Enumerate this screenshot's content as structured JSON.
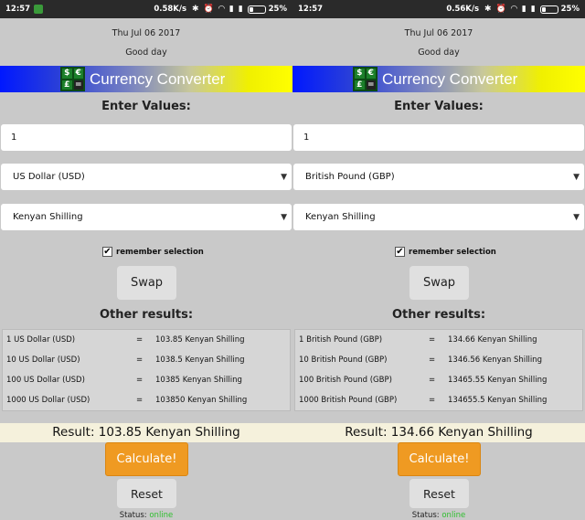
{
  "screens": [
    {
      "statusbar": {
        "time": "12:57",
        "speed": "0.58K/s",
        "battery": "25%"
      },
      "date": "Thu Jul 06 2017",
      "greeting": "Good day",
      "title": "Currency Converter",
      "enter_label": "Enter Values:",
      "amount": "1",
      "from_currency": "US Dollar (USD)",
      "to_currency": "Kenyan Shilling",
      "remember_label": "remember selection",
      "swap_label": "Swap",
      "other_results_label": "Other results:",
      "rows": [
        {
          "from": "1 US Dollar (USD)",
          "eq": "=",
          "to": "103.85 Kenyan Shilling"
        },
        {
          "from": "10 US Dollar (USD)",
          "eq": "=",
          "to": "1038.5 Kenyan Shilling"
        },
        {
          "from": "100 US Dollar (USD)",
          "eq": "=",
          "to": "10385 Kenyan Shilling"
        },
        {
          "from": "1000 US Dollar (USD)",
          "eq": "=",
          "to": "103850 Kenyan Shilling"
        }
      ],
      "result": "Result: 103.85 Kenyan Shilling",
      "calculate_label": "Calculate!",
      "reset_label": "Reset",
      "status_prefix": "Status:",
      "status_value": "online"
    },
    {
      "statusbar": {
        "time": "12:57",
        "speed": "0.56K/s",
        "battery": "25%"
      },
      "date": "Thu Jul 06 2017",
      "greeting": "Good day",
      "title": "Currency Converter",
      "enter_label": "Enter Values:",
      "amount": "1",
      "from_currency": "British Pound (GBP)",
      "to_currency": "Kenyan Shilling",
      "remember_label": "remember selection",
      "swap_label": "Swap",
      "other_results_label": "Other results:",
      "rows": [
        {
          "from": "1 British Pound (GBP)",
          "eq": "=",
          "to": "134.66 Kenyan Shilling"
        },
        {
          "from": "10 British Pound (GBP)",
          "eq": "=",
          "to": "1346.56 Kenyan Shilling"
        },
        {
          "from": "100 British Pound (GBP)",
          "eq": "=",
          "to": "13465.55 Kenyan Shilling"
        },
        {
          "from": "1000 British Pound (GBP)",
          "eq": "=",
          "to": "134655.5 Kenyan Shilling"
        }
      ],
      "result": "Result: 134.66 Kenyan Shilling",
      "calculate_label": "Calculate!",
      "reset_label": "Reset",
      "status_prefix": "Status:",
      "status_value": "online"
    }
  ],
  "colors": {
    "accent": "#ef9a22",
    "online": "#2fbf2f",
    "background": "#c9c9c9"
  },
  "icons": {
    "logo": [
      "$",
      "€",
      "£",
      "="
    ]
  }
}
